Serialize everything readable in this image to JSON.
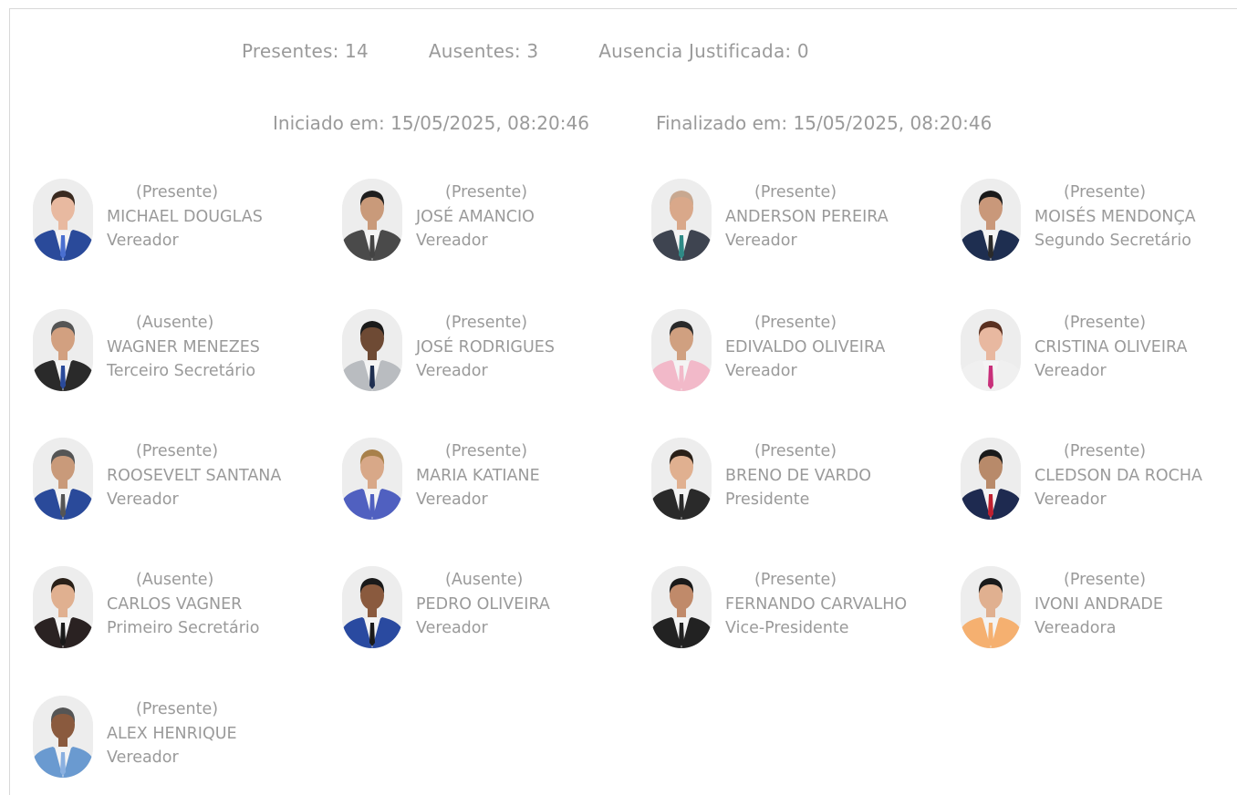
{
  "summary": {
    "presentes": "Presentes: 14",
    "ausentes": "Ausentes: 3",
    "justificada": "Ausencia Justificada: 0",
    "iniciado": "Iniciado em: 15/05/2025, 08:20:46",
    "finalizado": "Finalizado em: 15/05/2025, 08:20:46"
  },
  "members": [
    {
      "status": "(Presente)",
      "name": "MICHAEL DOUGLAS",
      "role": "Vereador",
      "suit": "#2a4a9a",
      "tie": "#4a6fd0",
      "skin": "#e8b9a0",
      "hair": "#3a2a20"
    },
    {
      "status": "(Presente)",
      "name": "JOSÉ AMANCIO",
      "role": "Vereador",
      "suit": "#4a4a4a",
      "tie": "#444444",
      "skin": "#c99a7a",
      "hair": "#1e1e1e"
    },
    {
      "status": "(Presente)",
      "name": "ANDERSON PEREIRA",
      "role": "Vereador",
      "suit": "#3e4450",
      "tie": "#2f8a86",
      "skin": "#d9a88a",
      "hair": "#c8a890"
    },
    {
      "status": "(Presente)",
      "name": "MOISÉS MENDONÇA",
      "role": "Segundo Secretário",
      "suit": "#1e2e50",
      "tie": "#2a2a2a",
      "skin": "#c9987a",
      "hair": "#1a1a1a"
    },
    {
      "status": "(Ausente)",
      "name": "WAGNER MENEZES",
      "role": "Terceiro Secretário",
      "suit": "#2a2a2a",
      "tie": "#2a4a9a",
      "skin": "#d2a080",
      "hair": "#555555"
    },
    {
      "status": "(Presente)",
      "name": "JOSÉ RODRIGUES",
      "role": "Vereador",
      "suit": "#b9bcc0",
      "tie": "#1e2e50",
      "skin": "#6e4a34",
      "hair": "#1a1a1a"
    },
    {
      "status": "(Presente)",
      "name": "EDIVALDO OLIVEIRA",
      "role": "Vereador",
      "suit": "#f2b9c9",
      "tie": "#f2b9c9",
      "skin": "#d0a080",
      "hair": "#2a2a2a"
    },
    {
      "status": "(Presente)",
      "name": "CRISTINA OLIVEIRA",
      "role": "Vereador",
      "suit": "#f0f0f0",
      "tie": "#c8307a",
      "skin": "#e8b8a0",
      "hair": "#5a3020"
    },
    {
      "status": "(Presente)",
      "name": "ROOSEVELT SANTANA",
      "role": "Vereador",
      "suit": "#2a4a9a",
      "tie": "#555555",
      "skin": "#c99a7a",
      "hair": "#555555"
    },
    {
      "status": "(Presente)",
      "name": "MARIA KATIANE",
      "role": "Vereador",
      "suit": "#5060c0",
      "tie": "#5060c0",
      "skin": "#d8a888",
      "hair": "#a8804a"
    },
    {
      "status": "(Presente)",
      "name": "BRENO DE VARDO",
      "role": "Presidente",
      "suit": "#2a2a2a",
      "tie": "#2a2a2a",
      "skin": "#e0b090",
      "hair": "#2a2018"
    },
    {
      "status": "(Presente)",
      "name": "CLEDSON DA ROCHA",
      "role": "Vereador",
      "suit": "#1e2a50",
      "tie": "#c02030",
      "skin": "#b88a6a",
      "hair": "#1a1a1a"
    },
    {
      "status": "(Ausente)",
      "name": "CARLOS VAGNER",
      "role": "Primeiro Secretário",
      "suit": "#2a2222",
      "tie": "#1a1a1a",
      "skin": "#e0b090",
      "hair": "#2a2018"
    },
    {
      "status": "(Ausente)",
      "name": "PEDRO OLIVEIRA",
      "role": "Vereador",
      "suit": "#2a4aa0",
      "tie": "#1a1a1a",
      "skin": "#8a5a3e",
      "hair": "#1a1a1a"
    },
    {
      "status": "(Presente)",
      "name": "FERNANDO CARVALHO",
      "role": "Vice-Presidente",
      "suit": "#222222",
      "tie": "#222222",
      "skin": "#c08a6a",
      "hair": "#1a1a1a"
    },
    {
      "status": "(Presente)",
      "name": "IVONI ANDRADE",
      "role": "Vereadora",
      "suit": "#f5b070",
      "tie": "#f5b070",
      "skin": "#e0b090",
      "hair": "#1a1a1a"
    },
    {
      "status": "(Presente)",
      "name": "ALEX HENRIQUE",
      "role": "Vereador",
      "suit": "#6a9ad0",
      "tie": "#8ab0e0",
      "skin": "#8a5a3e",
      "hair": "#555555"
    }
  ]
}
